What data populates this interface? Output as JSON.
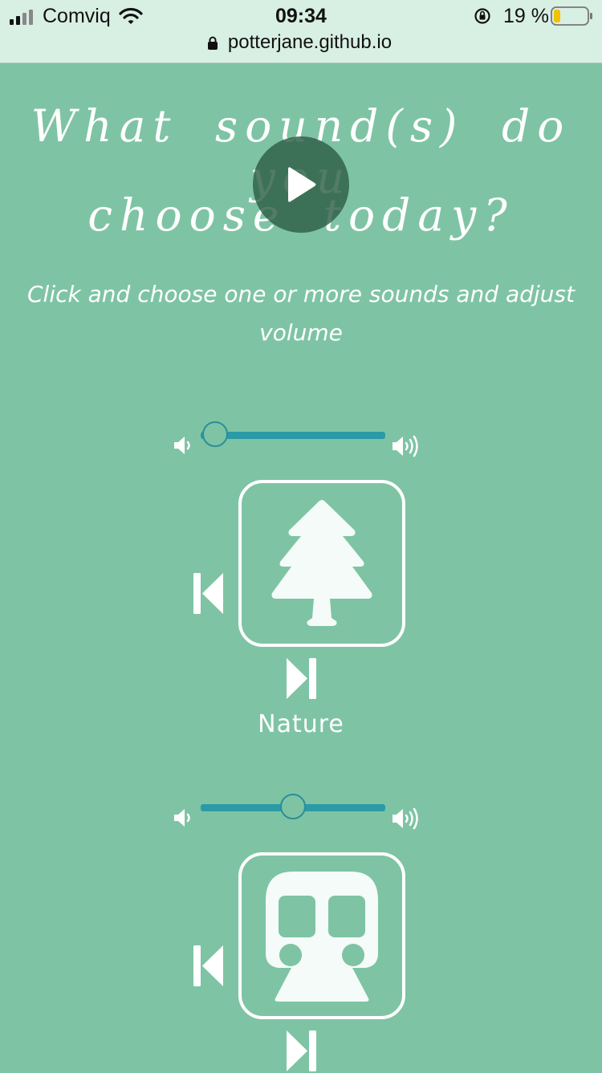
{
  "status_bar": {
    "carrier": "Comviq",
    "time": "09:34",
    "battery": "19 %",
    "url": "potterjane.github.io"
  },
  "title": {
    "line1": "What sound(s) do you",
    "line2": "choose today?"
  },
  "subtitle": "Click and choose one or more sounds and adjust volume",
  "sounds": [
    {
      "name": "Nature",
      "icon": "tree-icon",
      "volume": 0.08
    },
    {
      "name": "",
      "icon": "train-icon",
      "volume": 0.5
    }
  ],
  "colors": {
    "background": "#7ec4a4",
    "accent": "#2b9aa7",
    "status_bar": "#d8efe4"
  }
}
